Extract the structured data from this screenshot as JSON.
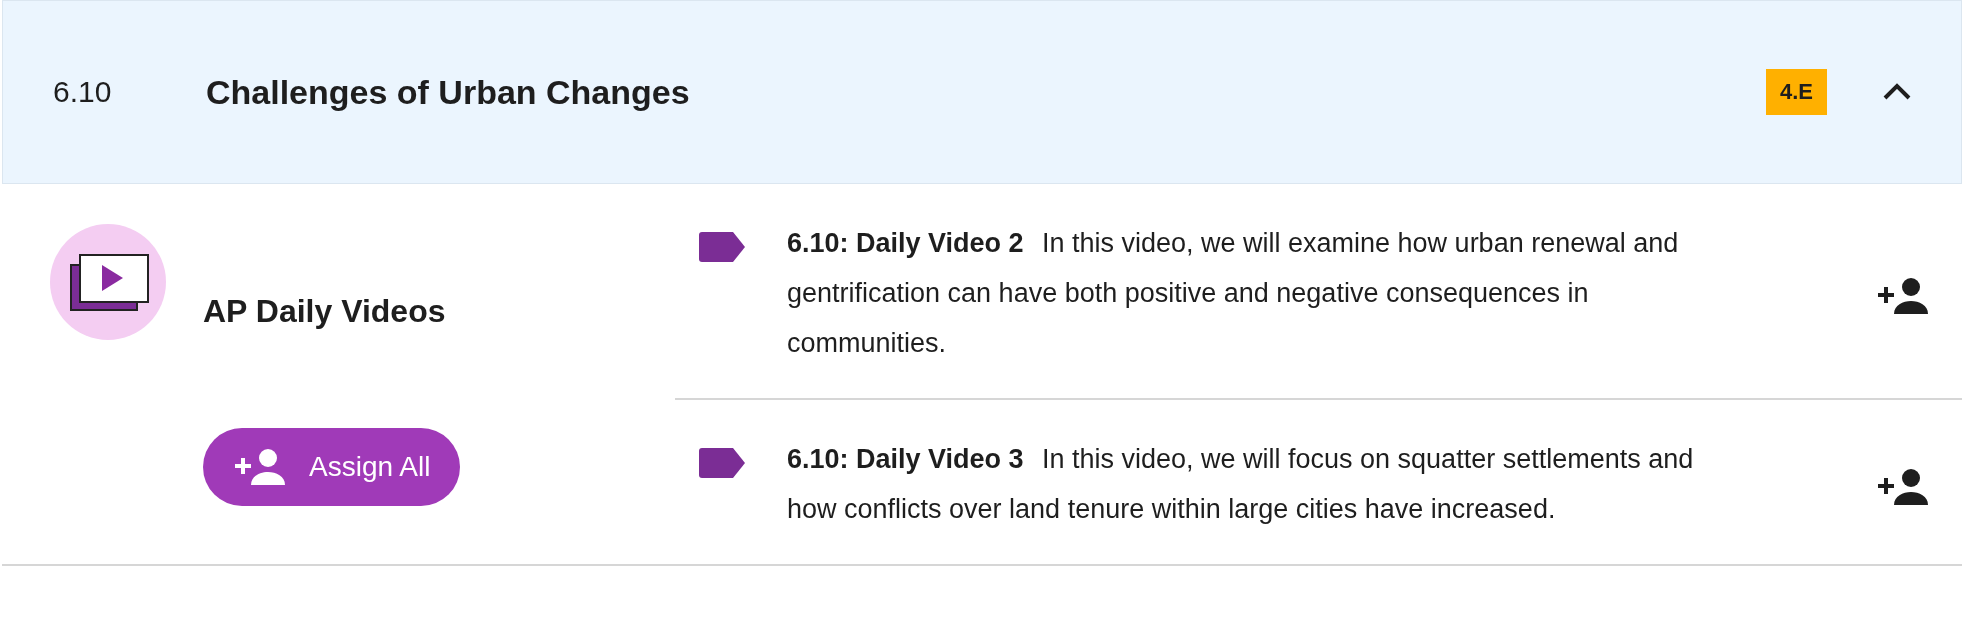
{
  "section": {
    "number": "6.10",
    "title": "Challenges of Urban Changes",
    "badge": "4.E",
    "expanded": true
  },
  "group": {
    "title": "AP Daily Videos",
    "assign_all": "Assign All"
  },
  "videos": [
    {
      "text": "**6.10: Daily Video 2** In this video, we will examine how urban renewal and gentrification can have both positive and negative consequences in communities."
    },
    {
      "text": "**6.10: Daily Video 3** In this video, we will focus on squatter settlements and how conflicts over land tenure within large cities have increased."
    }
  ]
}
